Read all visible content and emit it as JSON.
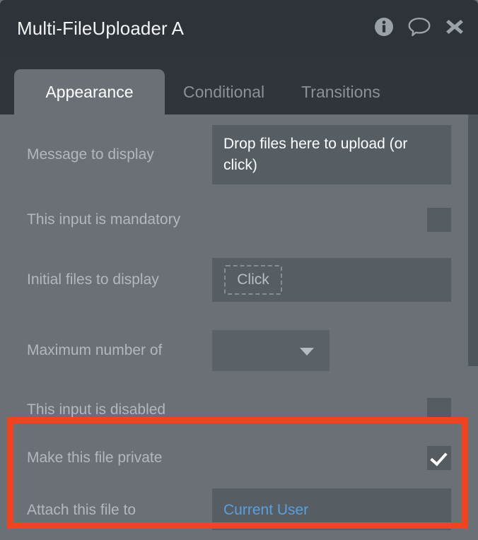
{
  "window": {
    "title": "Multi-FileUploader A",
    "actions": [
      {
        "name": "info-icon",
        "label": "Info"
      },
      {
        "name": "comment-icon",
        "label": "Comment"
      },
      {
        "name": "close-icon",
        "label": "Close"
      }
    ]
  },
  "tabs": [
    {
      "label": "Appearance",
      "active": true
    },
    {
      "label": "Conditional",
      "active": false
    },
    {
      "label": "Transitions",
      "active": false
    }
  ],
  "form": {
    "message": {
      "label": "Message to display",
      "value": "Drop files here to upload (or click)"
    },
    "mandatory": {
      "label": "This input is mandatory",
      "checked": false
    },
    "initial_files": {
      "label": "Initial files to display",
      "button_label": "Click"
    },
    "maximum": {
      "label": "Maximum number of",
      "value": ""
    },
    "disabled": {
      "label": "This input is disabled",
      "checked": false
    },
    "private": {
      "label": "Make this file private",
      "checked": true
    },
    "attach": {
      "label": "Attach this file to",
      "value": "Current User"
    }
  },
  "colors": {
    "highlight": "#f0431f",
    "link": "#5b9fe0",
    "panel": "#6a7076",
    "header": "#2d3338",
    "field": "#565e64"
  }
}
